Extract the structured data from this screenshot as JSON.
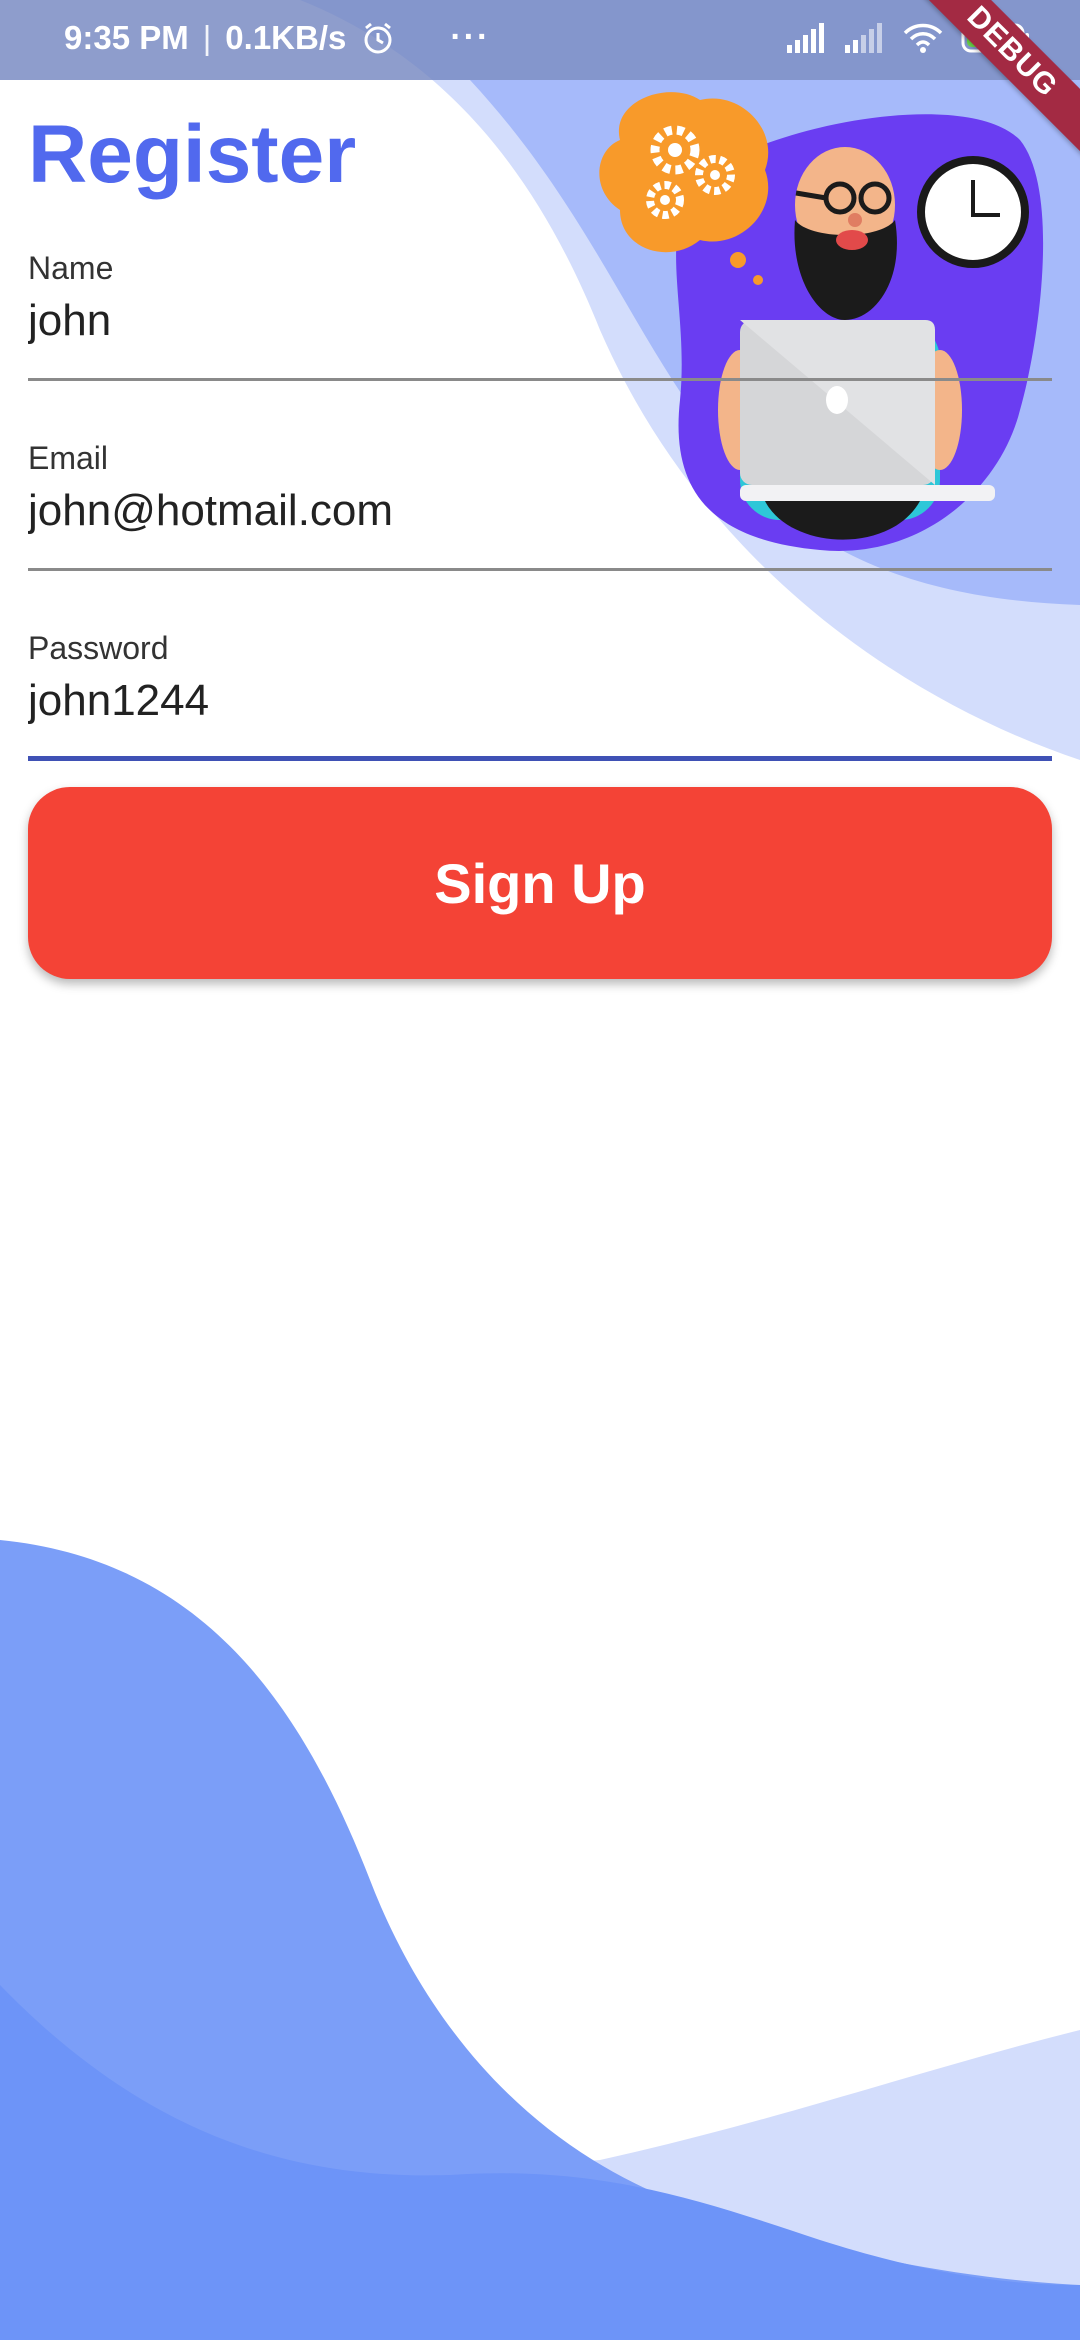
{
  "status_bar": {
    "time": "9:35 PM",
    "separator": "|",
    "speed": "0.1KB/s",
    "more": "···",
    "battery_level": "74",
    "icons": [
      "alarm-icon",
      "signal-icon",
      "signal-secondary-icon",
      "wifi-icon",
      "battery-charging-icon"
    ]
  },
  "debug_banner": "DEBUG",
  "page": {
    "title": "Register"
  },
  "form": {
    "name": {
      "label": "Name",
      "value": "john"
    },
    "email": {
      "label": "Email",
      "value": "john@hotmail.com"
    },
    "password": {
      "label": "Password",
      "value": "john1244"
    },
    "submit_label": "Sign Up"
  },
  "colors": {
    "title": "#5169ee",
    "button": "#f44336",
    "focus_underline": "#3f51b5",
    "wave_light": "#d3ddfc",
    "wave_mid": "#9fb6fa",
    "wave_dark": "#6e95f8",
    "status_bar": "#6e82be"
  },
  "illustration": {
    "icons": [
      "gear-icon",
      "clock-icon",
      "laptop-icon",
      "person-icon"
    ]
  }
}
